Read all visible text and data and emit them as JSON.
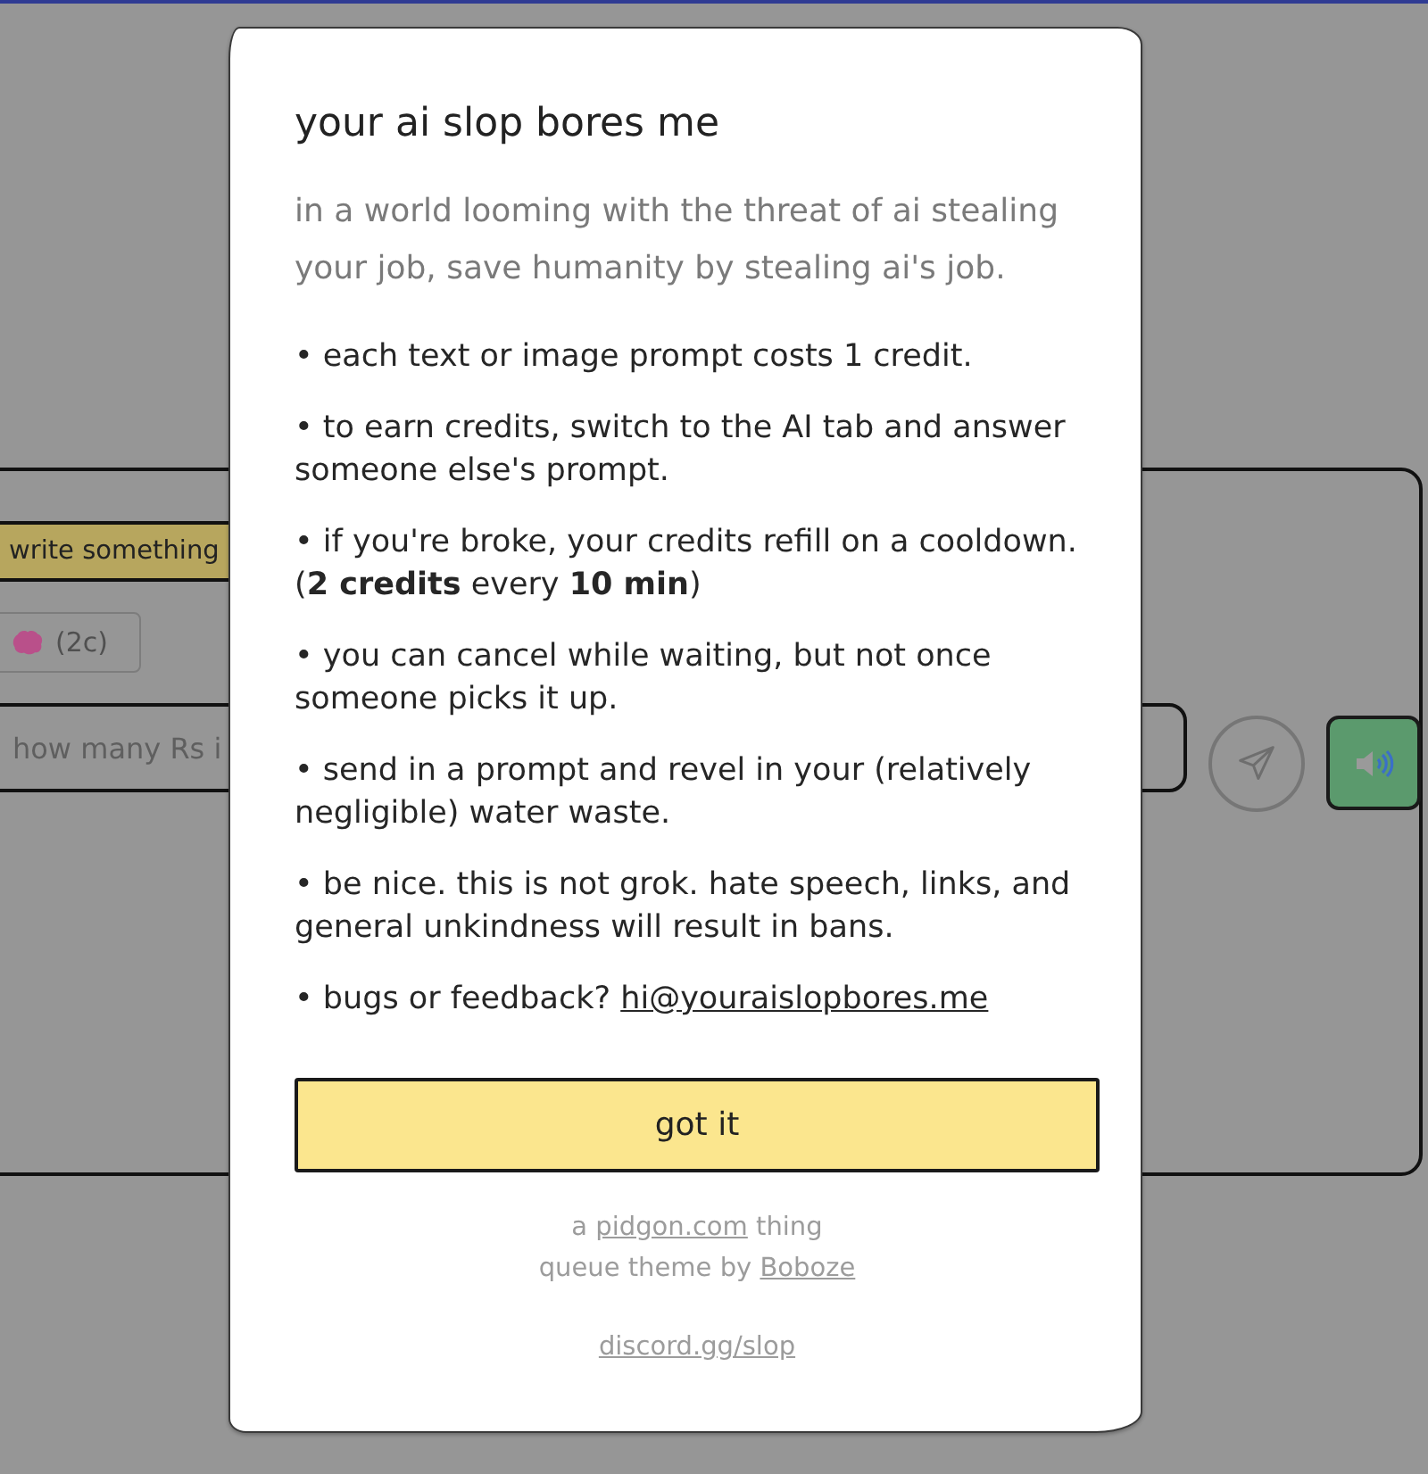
{
  "background": {
    "compose_tab": {
      "label": "write something",
      "selected": true
    },
    "model_button": {
      "label": "(2c)"
    },
    "prompt_input": {
      "placeholder": "how many Rs i"
    },
    "sound_toggle": {
      "on": true
    }
  },
  "dialog": {
    "title": "your ai slop bores me",
    "intro": "in a world looming with the threat of ai stealing your job, save humanity by stealing ai's job.",
    "rules": [
      {
        "text": "• each text or image prompt costs 1 credit."
      },
      {
        "text": "• to earn credits, switch to the AI tab and answer someone else's prompt."
      },
      {
        "text": "• if you're broke, your credits refill on a cooldown. (**2 credits** every **10 min**)"
      },
      {
        "text": "• you can cancel while waiting, but not once someone picks it up."
      },
      {
        "text": "• send in a prompt and revel in your (relatively negligible) water waste."
      },
      {
        "text": "• be nice. this is not grok. hate speech, links, and general unkindness will result in bans."
      },
      {
        "text": "• bugs or feedback?",
        "link": "hi@youraislopbores.me"
      }
    ],
    "button": "got it",
    "credits": [
      {
        "before": "a",
        "link": "pidgon.com",
        "after": "thing"
      },
      {
        "before": "queue theme by",
        "link": "Boboze"
      }
    ],
    "community_link": "discord.gg/slop"
  }
}
